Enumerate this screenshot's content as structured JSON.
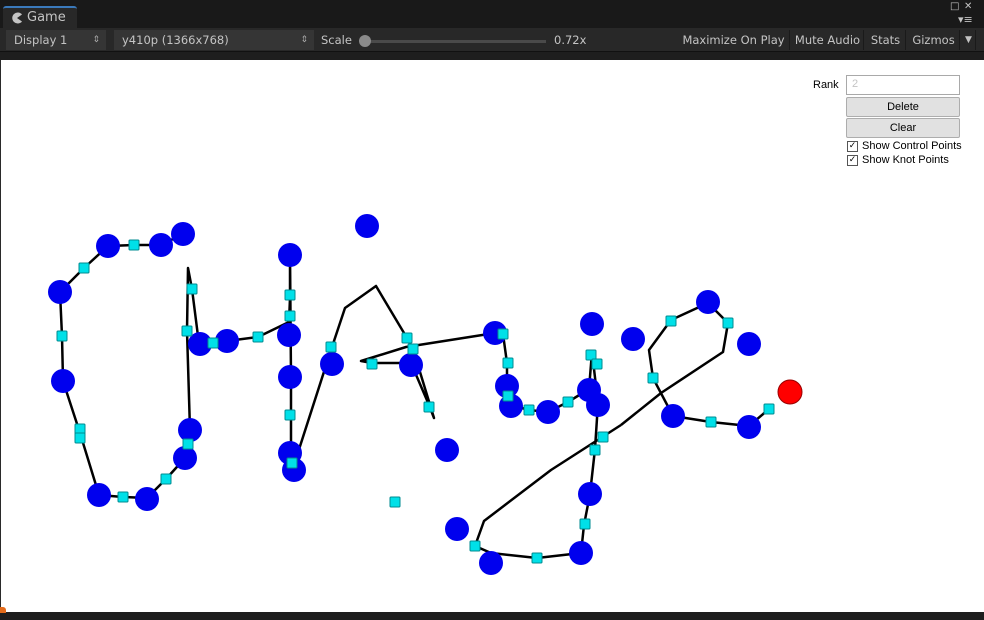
{
  "window": {
    "tab_label": "Game",
    "tab_icon": "pacman-icon"
  },
  "toolbar": {
    "display": "Display 1",
    "resolution": "y410p (1366x768)",
    "scale_label": "Scale",
    "scale_value": "0.72x",
    "scale_fraction": 0.0,
    "maximize": "Maximize On Play",
    "mute": "Mute Audio",
    "stats": "Stats",
    "gizmos": "Gizmos"
  },
  "panel": {
    "rank_label": "Rank",
    "rank_value": "2",
    "delete_label": "Delete",
    "clear_label": "Clear",
    "show_control_points": "Show Control Points",
    "show_control_points_checked": true,
    "show_knot_points": "Show Knot Points",
    "show_knot_points_checked": true
  },
  "colors": {
    "control_point": "#0000ee",
    "knot_point": "#00e0e8",
    "selected_point": "#ff0000",
    "curve": "#000000",
    "tab_accent": "#3a79bb"
  }
}
